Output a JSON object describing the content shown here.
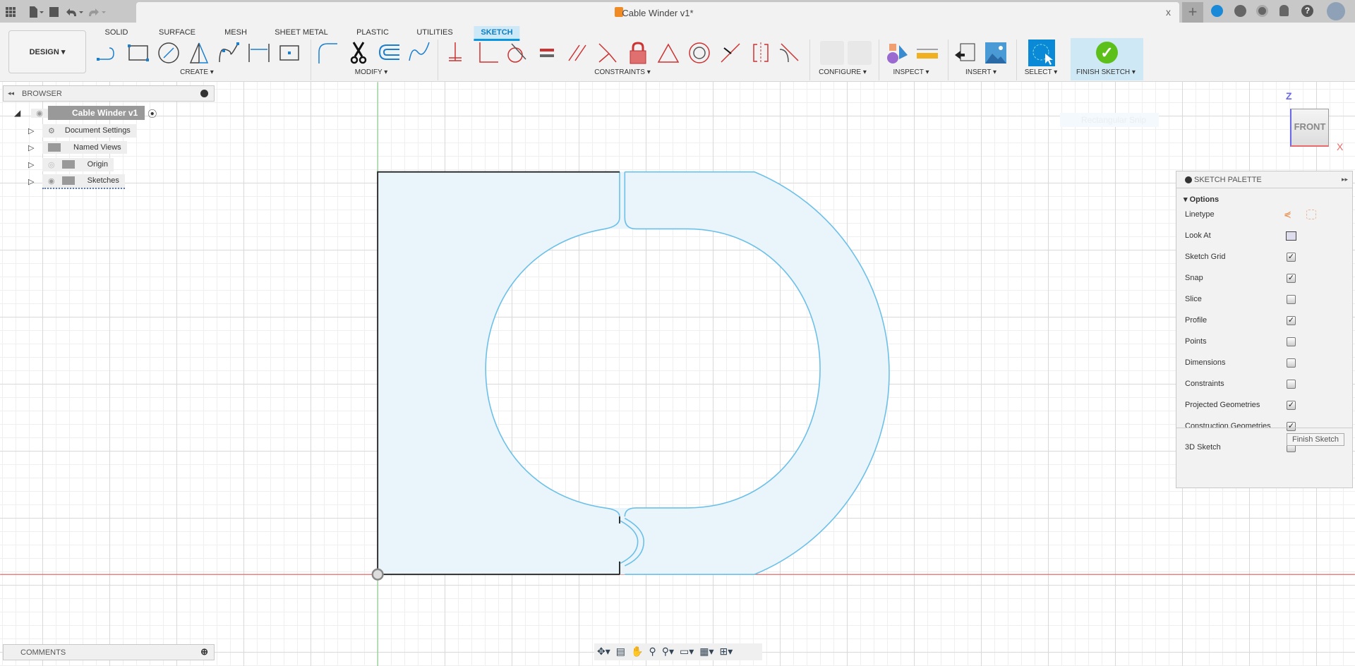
{
  "window": {
    "title": "Cable Winder v1*",
    "close": "x",
    "new_tab": "+"
  },
  "quick_access": {
    "icons": [
      "apps-grid-icon",
      "file-icon",
      "save-icon",
      "undo-icon",
      "redo-icon"
    ]
  },
  "header_icons": [
    "job-status-icon",
    "extensions-icon",
    "history-icon",
    "notifications-icon",
    "help-icon",
    "user-avatar-icon"
  ],
  "workspace": {
    "label": "DESIGN"
  },
  "tabs": [
    {
      "label": "SOLID"
    },
    {
      "label": "SURFACE"
    },
    {
      "label": "MESH"
    },
    {
      "label": "SHEET METAL"
    },
    {
      "label": "PLASTIC"
    },
    {
      "label": "UTILITIES"
    },
    {
      "label": "SKETCH",
      "active": true
    }
  ],
  "groups": {
    "create": "CREATE",
    "modify": "MODIFY",
    "constraints": "CONSTRAINTS",
    "configure": "CONFIGURE",
    "inspect": "INSPECT",
    "insert": "INSERT",
    "select": "SELECT",
    "finish": "FINISH SKETCH"
  },
  "browser": {
    "title": "BROWSER",
    "root": "Cable Winder v1",
    "items": [
      {
        "label": "Document Settings"
      },
      {
        "label": "Named Views"
      },
      {
        "label": "Origin"
      },
      {
        "label": "Sketches"
      }
    ]
  },
  "comments": {
    "title": "COMMENTS"
  },
  "ghost_tooltip": "Rectangular Snip",
  "viewcube": {
    "face": "FRONT",
    "z": "Z",
    "x": "X"
  },
  "palette": {
    "title": "SKETCH PALETTE",
    "section": "Options",
    "rows": [
      {
        "label": "Linetype",
        "type": "icons"
      },
      {
        "label": "Look At",
        "type": "icon"
      },
      {
        "label": "Sketch Grid",
        "checked": true
      },
      {
        "label": "Snap",
        "checked": true
      },
      {
        "label": "Slice",
        "checked": false
      },
      {
        "label": "Profile",
        "checked": true
      },
      {
        "label": "Points",
        "checked": false
      },
      {
        "label": "Dimensions",
        "checked": false
      },
      {
        "label": "Constraints",
        "checked": false
      },
      {
        "label": "Projected Geometries",
        "checked": true
      },
      {
        "label": "Construction Geometries",
        "checked": true
      },
      {
        "label": "3D Sketch",
        "checked": false
      }
    ],
    "finish": "Finish Sketch"
  },
  "colors": {
    "accent": "#0a96e0",
    "sketch_line": "#6cc0e8",
    "profile_fill": "#e9f4fb",
    "finish_green": "#5cbf1a",
    "x_axis": "#e86a6a",
    "y_axis": "#8ed08e"
  }
}
